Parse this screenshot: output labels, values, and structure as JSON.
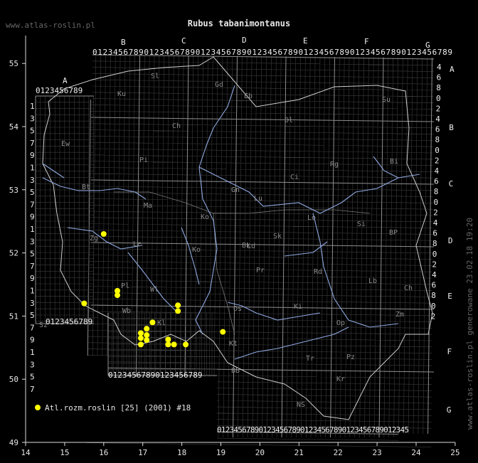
{
  "title": "Rubus tabanimontanus",
  "site_url": "www.atlas-roslin.pl",
  "footer_text": "www.atlas-roslin.pl generowane 23.02.18 19:20",
  "colors": {
    "background": "#000000",
    "grid": "#8c8c8c",
    "rivers": "#8fa8e0",
    "dots": "#ffff00"
  },
  "legend": {
    "label": "Atl.rozm.roslin [25] (2001) #18"
  },
  "axes": {
    "x_ticks": [
      "14",
      "15",
      "16",
      "17",
      "18",
      "19",
      "20",
      "21",
      "22",
      "23",
      "24",
      "25"
    ],
    "y_ticks": [
      "55",
      "54",
      "53",
      "52",
      "51",
      "50",
      "49"
    ],
    "x_range": [
      14,
      25
    ],
    "y_range": [
      49,
      55.5
    ]
  },
  "column_letters": [
    "A",
    "B",
    "C",
    "D",
    "E",
    "F",
    "G"
  ],
  "row_letters": [
    "A",
    "B",
    "C",
    "D",
    "E",
    "F",
    "G"
  ],
  "top_digits": "0123456789012345678901234567890123456789012345678901234567890123456789",
  "bottom_digits": "0123456789012345678901234567890123456789012345",
  "region_labels": [
    "Sl",
    "Ku",
    "Gd",
    "Eb",
    "Su",
    "Ch",
    "Ol",
    "Bi",
    "Pi",
    "Ci",
    "Rg",
    "Ew",
    "Ma",
    "Bt",
    "Gn",
    "Ko",
    "Lu",
    "Zg",
    "Le",
    "Lo",
    "Ko",
    "Bk",
    "Sk",
    "Ld",
    "Si",
    "BP",
    "Pr",
    "Rd",
    "Lb",
    "Ch",
    "Sz",
    "Wl",
    "Pl",
    "Wb",
    "Os",
    "Kl",
    "Ki",
    "Zm",
    "Op",
    "Kt",
    "Tr",
    "Pz",
    "BB",
    "NS",
    "Kr"
  ],
  "occurrences": [
    {
      "lon": 16.0,
      "lat": 52.3
    },
    {
      "lon": 16.35,
      "lat": 51.4
    },
    {
      "lon": 16.35,
      "lat": 51.33
    },
    {
      "lon": 15.5,
      "lat": 51.2
    },
    {
      "lon": 17.9,
      "lat": 51.17
    },
    {
      "lon": 17.9,
      "lat": 51.08
    },
    {
      "lon": 17.25,
      "lat": 50.9
    },
    {
      "lon": 17.1,
      "lat": 50.8
    },
    {
      "lon": 16.95,
      "lat": 50.73
    },
    {
      "lon": 17.1,
      "lat": 50.7
    },
    {
      "lon": 16.95,
      "lat": 50.65
    },
    {
      "lon": 17.1,
      "lat": 50.62
    },
    {
      "lon": 16.95,
      "lat": 50.55
    },
    {
      "lon": 17.65,
      "lat": 50.63
    },
    {
      "lon": 17.65,
      "lat": 50.55
    },
    {
      "lon": 17.8,
      "lat": 50.55
    },
    {
      "lon": 18.1,
      "lat": 50.55
    },
    {
      "lon": 19.05,
      "lat": 50.75
    }
  ]
}
